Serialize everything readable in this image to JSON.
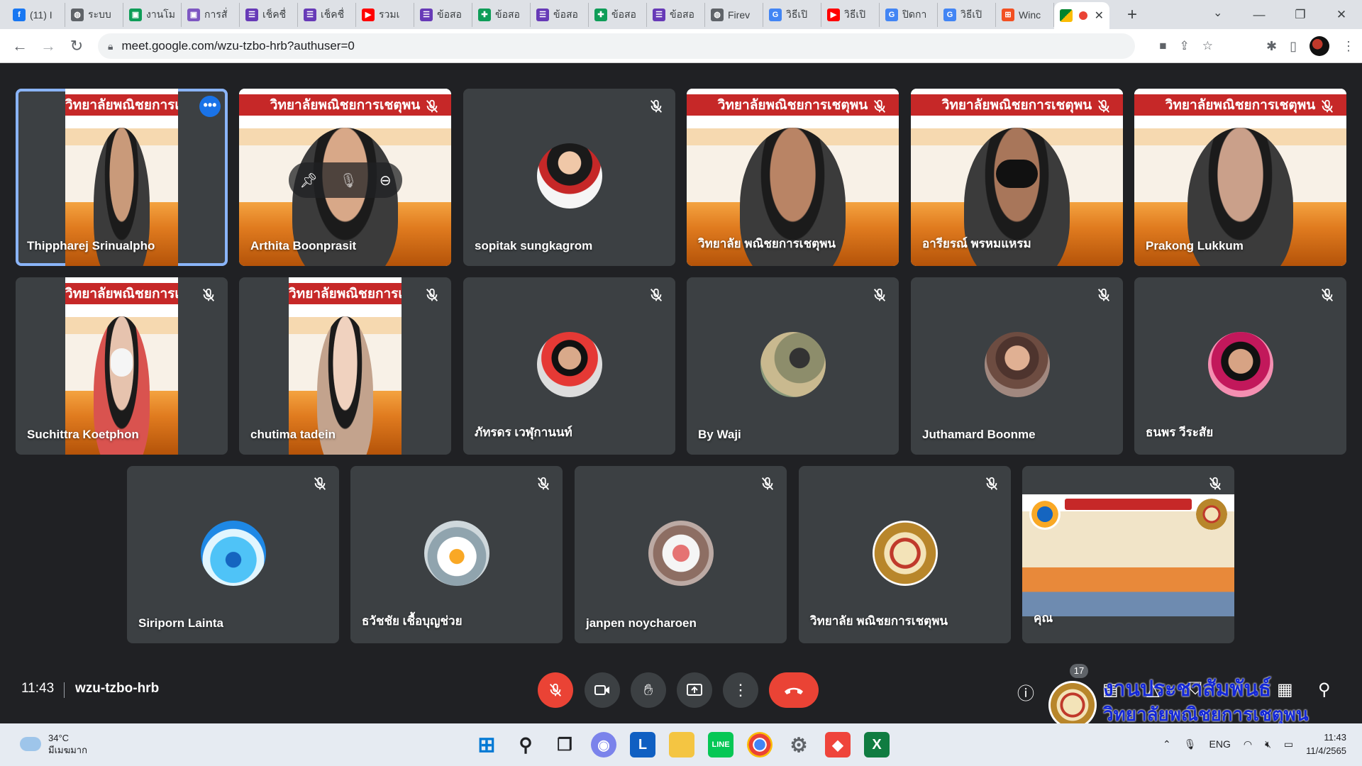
{
  "browser": {
    "tabs": [
      {
        "label": "(11) I",
        "icon": "facebook-icon",
        "color": "#1877f2",
        "glyph": "f"
      },
      {
        "label": "ระบบ",
        "icon": "globe-icon",
        "color": "#5f6368",
        "glyph": "◍"
      },
      {
        "label": "งานโม",
        "icon": "google-classroom-icon",
        "color": "#0f9d58",
        "glyph": "▣"
      },
      {
        "label": "การสั่",
        "icon": "google-classroom-icon",
        "color": "#7e57c2",
        "glyph": "▣"
      },
      {
        "label": "เช็คชื่",
        "icon": "google-forms-icon",
        "color": "#673ab7",
        "glyph": "☰"
      },
      {
        "label": "เช็คชื่",
        "icon": "google-forms-icon",
        "color": "#673ab7",
        "glyph": "☰"
      },
      {
        "label": "รวมเ",
        "icon": "youtube-icon",
        "color": "#ff0000",
        "glyph": "▶"
      },
      {
        "label": "ข้อสอ",
        "icon": "google-forms-icon",
        "color": "#673ab7",
        "glyph": "☰"
      },
      {
        "label": "ข้อสอ",
        "icon": "google-sheets-icon",
        "color": "#0f9d58",
        "glyph": "✚"
      },
      {
        "label": "ข้อสอ",
        "icon": "google-forms-icon",
        "color": "#673ab7",
        "glyph": "☰"
      },
      {
        "label": "ข้อสอ",
        "icon": "google-sheets-icon",
        "color": "#0f9d58",
        "glyph": "✚"
      },
      {
        "label": "ข้อสอ",
        "icon": "google-forms-icon",
        "color": "#673ab7",
        "glyph": "☰"
      },
      {
        "label": "Firev",
        "icon": "globe-icon",
        "color": "#5f6368",
        "glyph": "◍"
      },
      {
        "label": "วิธีเปิ",
        "icon": "google-icon",
        "color": "#4285f4",
        "glyph": "G"
      },
      {
        "label": "วิธีเปิ",
        "icon": "youtube-icon",
        "color": "#ff0000",
        "glyph": "▶"
      },
      {
        "label": "ปิดกา",
        "icon": "google-icon",
        "color": "#4285f4",
        "glyph": "G"
      },
      {
        "label": "วิธีเปิ",
        "icon": "google-icon",
        "color": "#4285f4",
        "glyph": "G"
      },
      {
        "label": "Winc",
        "icon": "windows-icon",
        "color": "#f25022",
        "glyph": "⊞"
      }
    ],
    "url": "meet.google.com/wzu-tzbo-hrb?authuser=0"
  },
  "participants": [
    {
      "name": "Thippharej Srinualpho",
      "type": "video",
      "speaking": true
    },
    {
      "name": "Arthita Boonprasit",
      "type": "video",
      "muted": true
    },
    {
      "name": "sopitak sungkagrom",
      "type": "avatar",
      "muted": true
    },
    {
      "name": "วิทยาลัย พณิชยการเชตุพน",
      "type": "video",
      "muted": true
    },
    {
      "name": "อารียรณ์ พรหมแหรม",
      "type": "video",
      "muted": true
    },
    {
      "name": "Prakong Lukkum",
      "type": "video",
      "muted": true
    },
    {
      "name": "Suchittra Koetphon",
      "type": "video",
      "muted": true
    },
    {
      "name": "chutima tadein",
      "type": "video",
      "muted": true
    },
    {
      "name": "ภัทรดร เวฬุกานนท์",
      "type": "avatar",
      "muted": true
    },
    {
      "name": "By Waji",
      "type": "avatar",
      "muted": true
    },
    {
      "name": "Juthamard Boonme",
      "type": "avatar",
      "muted": true
    },
    {
      "name": "ธนพร วีระสัย",
      "type": "avatar",
      "muted": true
    },
    {
      "name": "Siriporn Lainta",
      "type": "avatar",
      "muted": true
    },
    {
      "name": "ธวัชชัย เชื้อบุญช่วย",
      "type": "avatar",
      "muted": true
    },
    {
      "name": "janpen noycharoen",
      "type": "avatar",
      "muted": true
    },
    {
      "name": "วิทยาลัย พณิชยการเชตุพน",
      "type": "avatar",
      "muted": true
    },
    {
      "name": "คุณ",
      "type": "presentation",
      "muted": true
    }
  ],
  "banner_text": "วิทยาลัยพณิชยการเชตุพน",
  "meeting": {
    "time": "11:43",
    "code": "wzu-tzbo-hrb",
    "participant_count": "17"
  },
  "watermark": {
    "line1": "งานประชาสัมพันธ์",
    "line2": "วิทยาลัยพณิชยการเชตุพน"
  },
  "taskbar": {
    "temperature": "34°C",
    "weather_desc": "มีเมฆมาก",
    "language": "ENG",
    "time": "11:43",
    "date": "11/4/2565"
  },
  "colors": {
    "meet_bg": "#202124",
    "tile_bg": "#3c4043",
    "speaking_outline": "#8ab4f8",
    "end_call": "#ea4335"
  }
}
